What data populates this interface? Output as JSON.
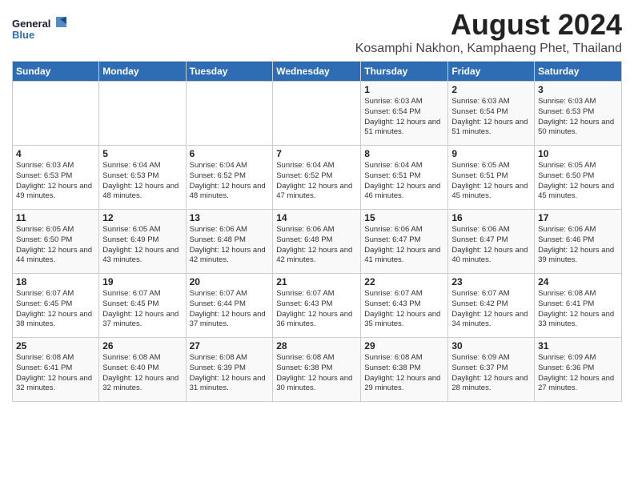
{
  "header": {
    "logo_general": "General",
    "logo_blue": "Blue",
    "title": "August 2024",
    "subtitle": "Kosamphi Nakhon, Kamphaeng Phet, Thailand"
  },
  "weekdays": [
    "Sunday",
    "Monday",
    "Tuesday",
    "Wednesday",
    "Thursday",
    "Friday",
    "Saturday"
  ],
  "weeks": [
    [
      {
        "day": "",
        "sunrise": "",
        "sunset": "",
        "daylight": ""
      },
      {
        "day": "",
        "sunrise": "",
        "sunset": "",
        "daylight": ""
      },
      {
        "day": "",
        "sunrise": "",
        "sunset": "",
        "daylight": ""
      },
      {
        "day": "",
        "sunrise": "",
        "sunset": "",
        "daylight": ""
      },
      {
        "day": "1",
        "sunrise": "Sunrise: 6:03 AM",
        "sunset": "Sunset: 6:54 PM",
        "daylight": "Daylight: 12 hours and 51 minutes."
      },
      {
        "day": "2",
        "sunrise": "Sunrise: 6:03 AM",
        "sunset": "Sunset: 6:54 PM",
        "daylight": "Daylight: 12 hours and 51 minutes."
      },
      {
        "day": "3",
        "sunrise": "Sunrise: 6:03 AM",
        "sunset": "Sunset: 6:53 PM",
        "daylight": "Daylight: 12 hours and 50 minutes."
      }
    ],
    [
      {
        "day": "4",
        "sunrise": "Sunrise: 6:03 AM",
        "sunset": "Sunset: 6:53 PM",
        "daylight": "Daylight: 12 hours and 49 minutes."
      },
      {
        "day": "5",
        "sunrise": "Sunrise: 6:04 AM",
        "sunset": "Sunset: 6:53 PM",
        "daylight": "Daylight: 12 hours and 48 minutes."
      },
      {
        "day": "6",
        "sunrise": "Sunrise: 6:04 AM",
        "sunset": "Sunset: 6:52 PM",
        "daylight": "Daylight: 12 hours and 48 minutes."
      },
      {
        "day": "7",
        "sunrise": "Sunrise: 6:04 AM",
        "sunset": "Sunset: 6:52 PM",
        "daylight": "Daylight: 12 hours and 47 minutes."
      },
      {
        "day": "8",
        "sunrise": "Sunrise: 6:04 AM",
        "sunset": "Sunset: 6:51 PM",
        "daylight": "Daylight: 12 hours and 46 minutes."
      },
      {
        "day": "9",
        "sunrise": "Sunrise: 6:05 AM",
        "sunset": "Sunset: 6:51 PM",
        "daylight": "Daylight: 12 hours and 45 minutes."
      },
      {
        "day": "10",
        "sunrise": "Sunrise: 6:05 AM",
        "sunset": "Sunset: 6:50 PM",
        "daylight": "Daylight: 12 hours and 45 minutes."
      }
    ],
    [
      {
        "day": "11",
        "sunrise": "Sunrise: 6:05 AM",
        "sunset": "Sunset: 6:50 PM",
        "daylight": "Daylight: 12 hours and 44 minutes."
      },
      {
        "day": "12",
        "sunrise": "Sunrise: 6:05 AM",
        "sunset": "Sunset: 6:49 PM",
        "daylight": "Daylight: 12 hours and 43 minutes."
      },
      {
        "day": "13",
        "sunrise": "Sunrise: 6:06 AM",
        "sunset": "Sunset: 6:48 PM",
        "daylight": "Daylight: 12 hours and 42 minutes."
      },
      {
        "day": "14",
        "sunrise": "Sunrise: 6:06 AM",
        "sunset": "Sunset: 6:48 PM",
        "daylight": "Daylight: 12 hours and 42 minutes."
      },
      {
        "day": "15",
        "sunrise": "Sunrise: 6:06 AM",
        "sunset": "Sunset: 6:47 PM",
        "daylight": "Daylight: 12 hours and 41 minutes."
      },
      {
        "day": "16",
        "sunrise": "Sunrise: 6:06 AM",
        "sunset": "Sunset: 6:47 PM",
        "daylight": "Daylight: 12 hours and 40 minutes."
      },
      {
        "day": "17",
        "sunrise": "Sunrise: 6:06 AM",
        "sunset": "Sunset: 6:46 PM",
        "daylight": "Daylight: 12 hours and 39 minutes."
      }
    ],
    [
      {
        "day": "18",
        "sunrise": "Sunrise: 6:07 AM",
        "sunset": "Sunset: 6:45 PM",
        "daylight": "Daylight: 12 hours and 38 minutes."
      },
      {
        "day": "19",
        "sunrise": "Sunrise: 6:07 AM",
        "sunset": "Sunset: 6:45 PM",
        "daylight": "Daylight: 12 hours and 37 minutes."
      },
      {
        "day": "20",
        "sunrise": "Sunrise: 6:07 AM",
        "sunset": "Sunset: 6:44 PM",
        "daylight": "Daylight: 12 hours and 37 minutes."
      },
      {
        "day": "21",
        "sunrise": "Sunrise: 6:07 AM",
        "sunset": "Sunset: 6:43 PM",
        "daylight": "Daylight: 12 hours and 36 minutes."
      },
      {
        "day": "22",
        "sunrise": "Sunrise: 6:07 AM",
        "sunset": "Sunset: 6:43 PM",
        "daylight": "Daylight: 12 hours and 35 minutes."
      },
      {
        "day": "23",
        "sunrise": "Sunrise: 6:07 AM",
        "sunset": "Sunset: 6:42 PM",
        "daylight": "Daylight: 12 hours and 34 minutes."
      },
      {
        "day": "24",
        "sunrise": "Sunrise: 6:08 AM",
        "sunset": "Sunset: 6:41 PM",
        "daylight": "Daylight: 12 hours and 33 minutes."
      }
    ],
    [
      {
        "day": "25",
        "sunrise": "Sunrise: 6:08 AM",
        "sunset": "Sunset: 6:41 PM",
        "daylight": "Daylight: 12 hours and 32 minutes."
      },
      {
        "day": "26",
        "sunrise": "Sunrise: 6:08 AM",
        "sunset": "Sunset: 6:40 PM",
        "daylight": "Daylight: 12 hours and 32 minutes."
      },
      {
        "day": "27",
        "sunrise": "Sunrise: 6:08 AM",
        "sunset": "Sunset: 6:39 PM",
        "daylight": "Daylight: 12 hours and 31 minutes."
      },
      {
        "day": "28",
        "sunrise": "Sunrise: 6:08 AM",
        "sunset": "Sunset: 6:38 PM",
        "daylight": "Daylight: 12 hours and 30 minutes."
      },
      {
        "day": "29",
        "sunrise": "Sunrise: 6:08 AM",
        "sunset": "Sunset: 6:38 PM",
        "daylight": "Daylight: 12 hours and 29 minutes."
      },
      {
        "day": "30",
        "sunrise": "Sunrise: 6:09 AM",
        "sunset": "Sunset: 6:37 PM",
        "daylight": "Daylight: 12 hours and 28 minutes."
      },
      {
        "day": "31",
        "sunrise": "Sunrise: 6:09 AM",
        "sunset": "Sunset: 6:36 PM",
        "daylight": "Daylight: 12 hours and 27 minutes."
      }
    ]
  ]
}
